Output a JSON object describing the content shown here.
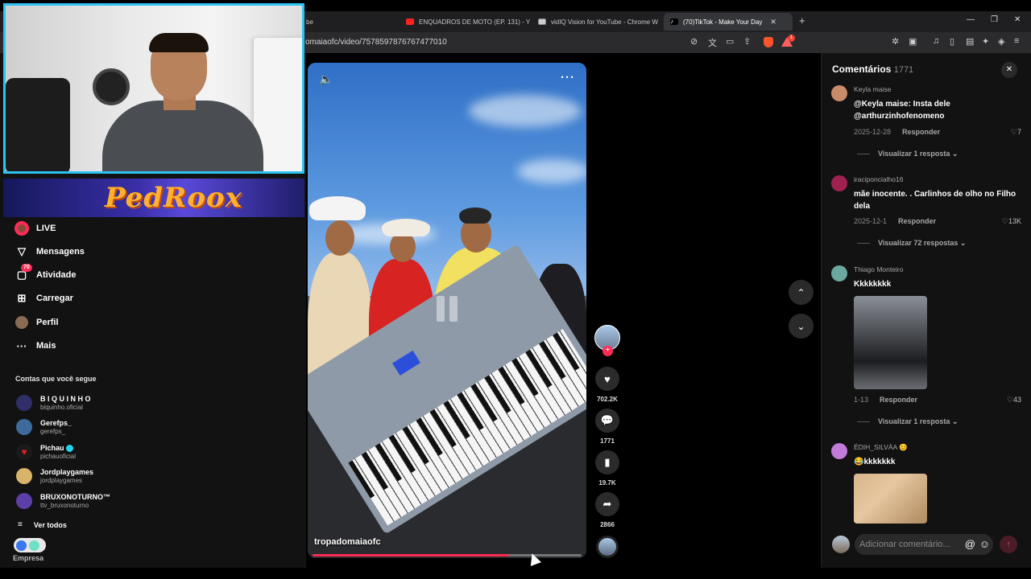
{
  "browser": {
    "tabs": [
      {
        "label": "be",
        "color": "transparent"
      },
      {
        "label": "ENQUADROS DE MOTO (EP. 131) - Y",
        "color": "#ff2020"
      },
      {
        "label": "vidIQ Vision for YouTube - Chrome W",
        "color": "#cccccc"
      },
      {
        "label": "(70)TikTok - Make Your Day",
        "color": "#ffffff",
        "close": "✕"
      }
    ],
    "url": "omaiaofc/video/7578597876767477010",
    "shield_count": "1"
  },
  "sidebar": {
    "nav": [
      {
        "label": "LIVE",
        "icon": "live-icon"
      },
      {
        "label": "Mensagens",
        "icon": "messages-icon"
      },
      {
        "label": "Atividade",
        "icon": "activity-icon",
        "badge": "70"
      },
      {
        "label": "Carregar",
        "icon": "upload-icon"
      },
      {
        "label": "Perfil",
        "icon": "profile-icon"
      },
      {
        "label": "Mais",
        "icon": "more-icon"
      }
    ],
    "following_title": "Contas que você segue",
    "following": [
      {
        "name": "B I Q U I N H O",
        "user": "biquinho.oficial",
        "color": "#2f2f6a"
      },
      {
        "name": "Gerefps_",
        "user": "gerefps_",
        "color": "#3f6b9a"
      },
      {
        "name": "Pichau",
        "user": "pichauoficial",
        "color": "#e02020",
        "verified": true
      },
      {
        "name": "Jordplaygames",
        "user": "jordplaygames",
        "color": "#d8b46a"
      },
      {
        "name": "BRUXONOTURNO™",
        "user": "ttv_bruxonoturno",
        "color": "#5d3fa8"
      }
    ],
    "see_all": "Ver todos",
    "empresa": "Empresa",
    "banner_text": "PedRoox"
  },
  "video": {
    "author": "tropadomaiaofc",
    "progress": 0.73,
    "likes": "702.2K",
    "comments": "1771",
    "saves": "19.7K",
    "shares": "2866"
  },
  "comments": {
    "title": "Comentários",
    "count": "1771",
    "reply_label": "Responder",
    "input_placeholder": "Adicionar comentário...",
    "items": [
      {
        "user": "Keyla maise",
        "text": "@Keyla maise: Insta dele @arthurzinhofenomeno",
        "date": "2025-12-28",
        "likes": "7",
        "replies": "Visualizar 1 resposta",
        "color": "#c98c6b"
      },
      {
        "user": "iraciponcialho16",
        "text": "mãe inocente. . Carlinhos de olho no Filho dela",
        "date": "2025-12-1",
        "likes": "13K",
        "replies": "Visualizar 72 respostas",
        "color": "#a02050"
      },
      {
        "user": "Thiago Monteiro",
        "text": "Kkkkkkkk",
        "date": "1-13",
        "likes": "43",
        "replies": "Visualizar 1 resposta",
        "color": "#6aa8a0"
      },
      {
        "user": "ÉDIH_SILVÀA 😊",
        "text": "😂kkkkkkk",
        "color": "#c27bd8"
      }
    ]
  }
}
